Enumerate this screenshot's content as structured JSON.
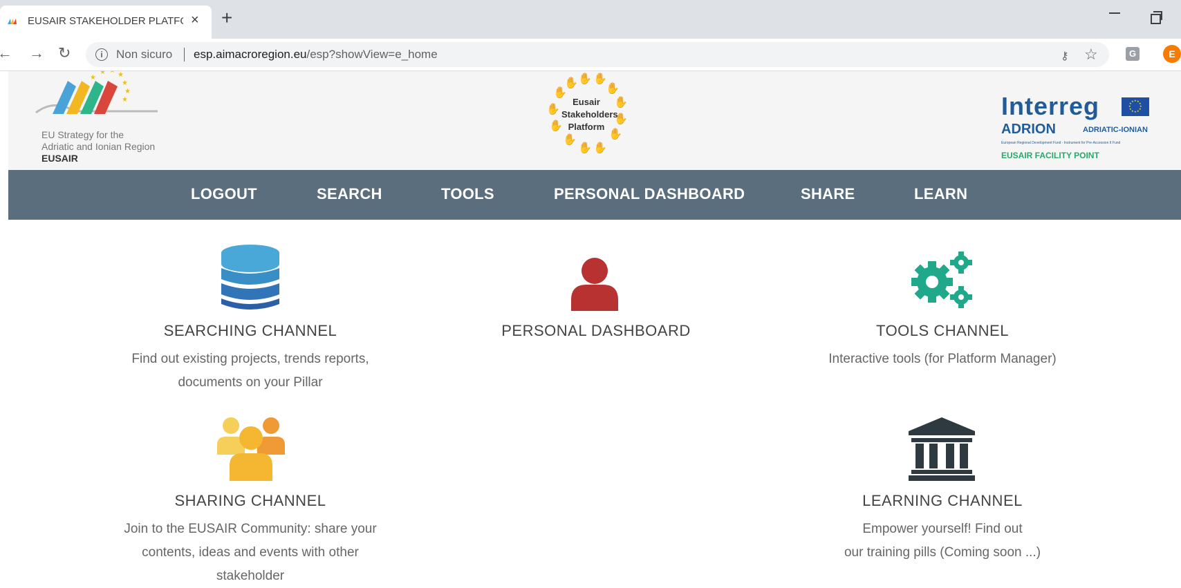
{
  "browser": {
    "tab_title": "EUSAIR STAKEHOLDER PLATFORM",
    "security_label": "Non sicuro",
    "url_host": "esp.aimacroregion.eu",
    "url_path": "/esp?showView=e_home",
    "profile_initial": "E",
    "extension_letter": "G"
  },
  "header": {
    "eusair_tagline_line1": "EU Strategy for the",
    "eusair_tagline_line2": "Adriatic and Ionian Region",
    "eusair_name": "EUSAIR",
    "esp_logo_line1": "Eusair",
    "esp_logo_line2": "Stakeholders",
    "esp_logo_line3": "Platform",
    "interreg_title": "Interreg",
    "interreg_program": "ADRION",
    "interreg_region": "ADRIATIC-IONIAN",
    "interreg_fund": "European Regional Development Fund - Instrument for Pre-Accession II Fund",
    "facility_label": "EUSAIR FACILITY POINT"
  },
  "nav": {
    "items": [
      "LOGOUT",
      "SEARCH",
      "TOOLS",
      "PERSONAL DASHBOARD",
      "SHARE",
      "LEARN"
    ]
  },
  "channels": {
    "searching": {
      "title": "SEARCHING CHANNEL",
      "desc_line1": "Find out existing projects, trends reports,",
      "desc_line2": "documents on your Pillar",
      "icon": "database-icon"
    },
    "dashboard": {
      "title": "PERSONAL DASHBOARD",
      "icon": "user-icon"
    },
    "tools": {
      "title": "TOOLS CHANNEL",
      "desc_line1": "Interactive tools (for Platform Manager)",
      "icon": "gears-icon"
    },
    "sharing": {
      "title": "SHARING CHANNEL",
      "desc_line1": "Join to the EUSAIR Community: share your",
      "desc_line2": "contents, ideas and events with other",
      "desc_line3": "stakeholder",
      "icon": "users-icon"
    },
    "learning": {
      "title": "LEARNING CHANNEL",
      "desc_line1": "Empower yourself! Find out",
      "desc_line2": "our training pills (Coming soon ...)",
      "icon": "institution-icon"
    }
  },
  "colors": {
    "nav_bg": "#5b6e7e",
    "database": "#3a86c8",
    "user": "#b83232",
    "gears": "#1fa88a",
    "users": "#f5b731",
    "institution": "#2e3a3f"
  }
}
